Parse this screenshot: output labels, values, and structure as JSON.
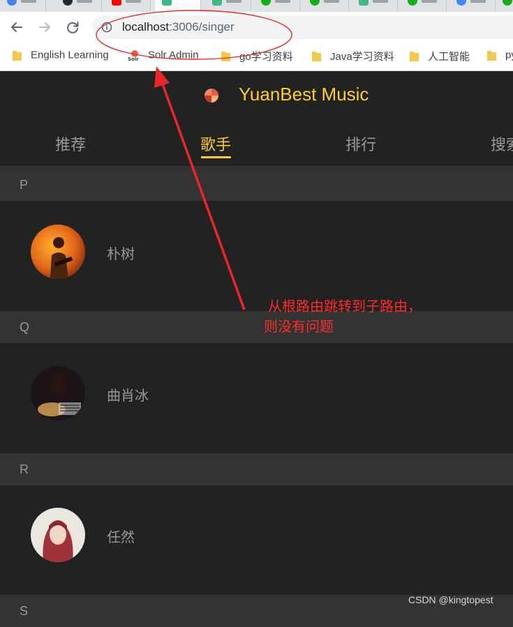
{
  "browser": {
    "address_bar": {
      "host": "localhost",
      "path": ":3006/singer"
    },
    "bookmarks": [
      {
        "label": "English Learning",
        "icon": "folder-icon"
      },
      {
        "label": "Solr Admin",
        "icon": "solr-icon"
      },
      {
        "label": "go学习资料",
        "icon": "folder-icon"
      },
      {
        "label": "Java学习资料",
        "icon": "folder-icon"
      },
      {
        "label": "人工智能",
        "icon": "folder-icon"
      },
      {
        "label": "py",
        "icon": "folder-icon"
      }
    ],
    "colors": {
      "folder": "#f2c94c",
      "chrome_bg": "#ffffff"
    }
  },
  "app": {
    "title": "YuanBest Music",
    "accent": "#ffcd32",
    "nav_tabs": [
      {
        "label": "推荐",
        "active": false
      },
      {
        "label": "歌手",
        "active": true
      },
      {
        "label": "排行",
        "active": false
      },
      {
        "label": "搜索",
        "active": false
      }
    ],
    "groups": [
      {
        "letter": "P",
        "singers": [
          {
            "name": "朴树",
            "avatar": "avatar-photo"
          }
        ]
      },
      {
        "letter": "Q",
        "singers": [
          {
            "name": "曲肖冰",
            "avatar": "avatar-photo"
          }
        ]
      },
      {
        "letter": "R",
        "singers": [
          {
            "name": "任然",
            "avatar": "avatar-photo"
          }
        ]
      },
      {
        "letter": "S",
        "singers": []
      }
    ]
  },
  "annotation": {
    "text_line1": "从根路由跳转到子路由，",
    "text_line2": "则没有问题",
    "color": "#ff2a2a"
  },
  "watermark": "CSDN @kingtopest"
}
